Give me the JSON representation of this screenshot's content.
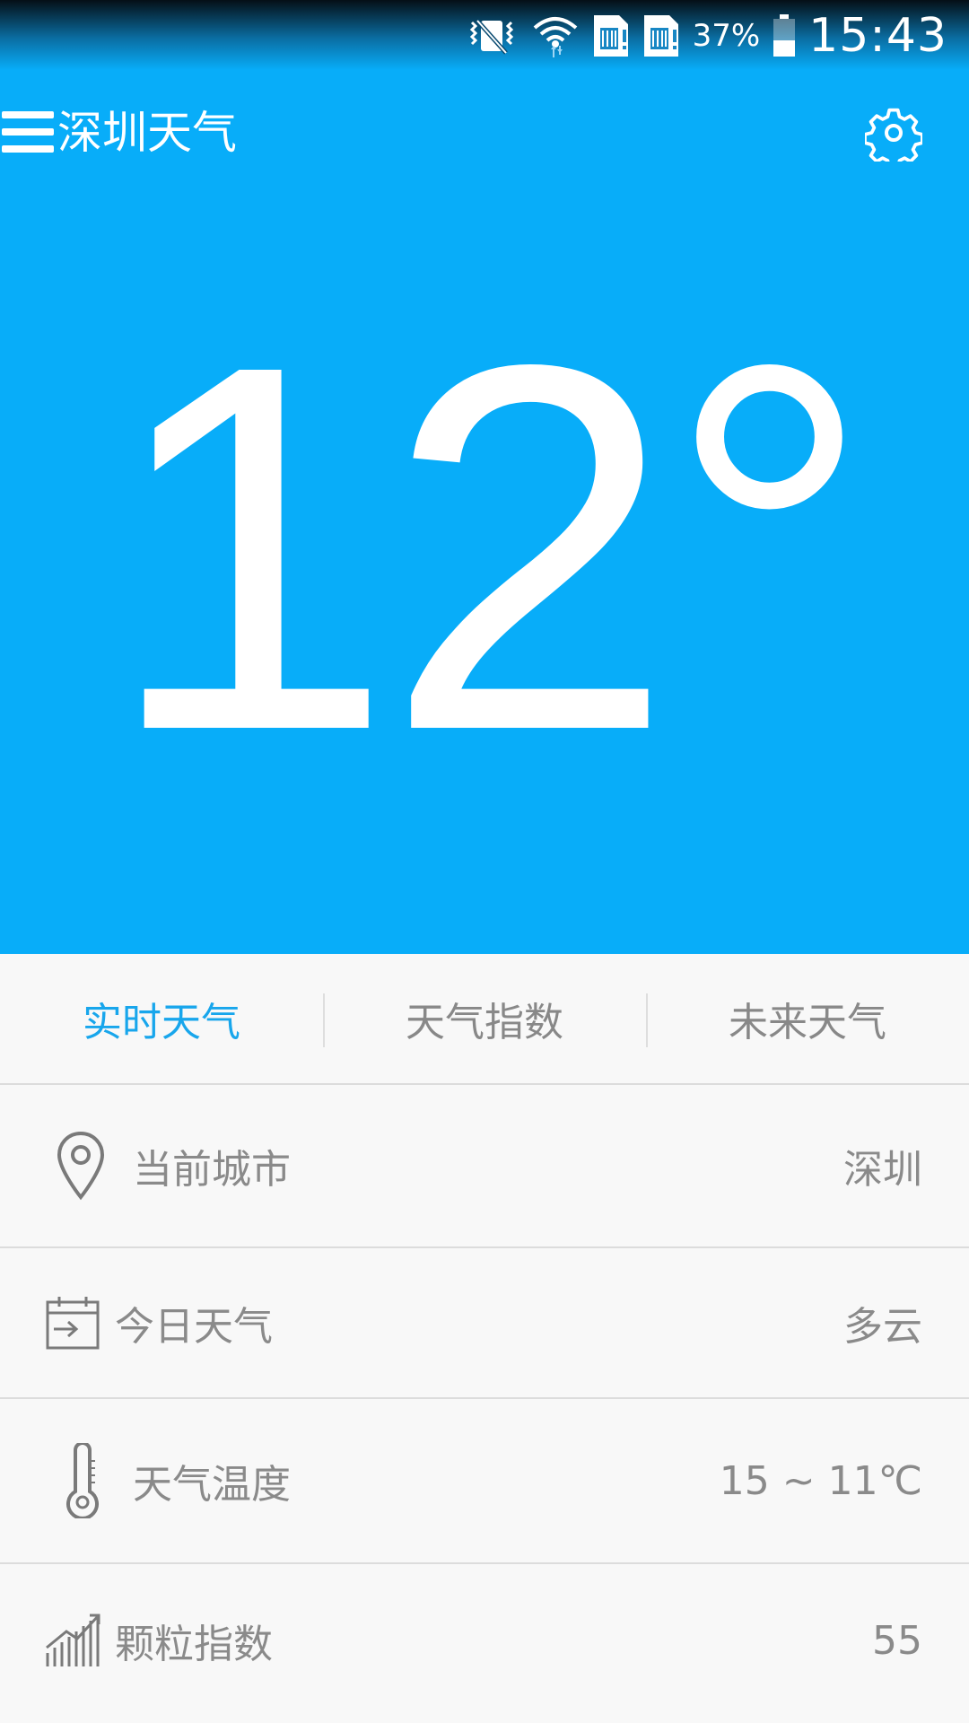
{
  "status_bar": {
    "battery_percent": "37%",
    "time": "15:43",
    "icons": [
      "vibrate-mute-icon",
      "wifi-icon",
      "sim1-icon",
      "sim2-icon",
      "battery-icon"
    ]
  },
  "app_bar": {
    "title": "深圳天气",
    "menu_icon": "hamburger-menu-icon",
    "settings_icon": "gear-icon"
  },
  "current": {
    "temperature": "12°"
  },
  "tabs": [
    {
      "label": "实时天气",
      "active": true
    },
    {
      "label": "天气指数",
      "active": false
    },
    {
      "label": "未来天气",
      "active": false
    }
  ],
  "rows": [
    {
      "icon": "location-pin-icon",
      "label": "当前城市",
      "value": "深圳"
    },
    {
      "icon": "calendar-icon",
      "label": "今日天气",
      "value": "多云"
    },
    {
      "icon": "thermometer-icon",
      "label": "天气温度",
      "value": "15 ~ 11℃"
    },
    {
      "icon": "bar-chart-icon",
      "label": "颗粒指数",
      "value": "55"
    }
  ],
  "colors": {
    "hero_background": "#08adf9",
    "active_tab": "#18a6ec",
    "secondary_text": "#8a8a8a"
  }
}
